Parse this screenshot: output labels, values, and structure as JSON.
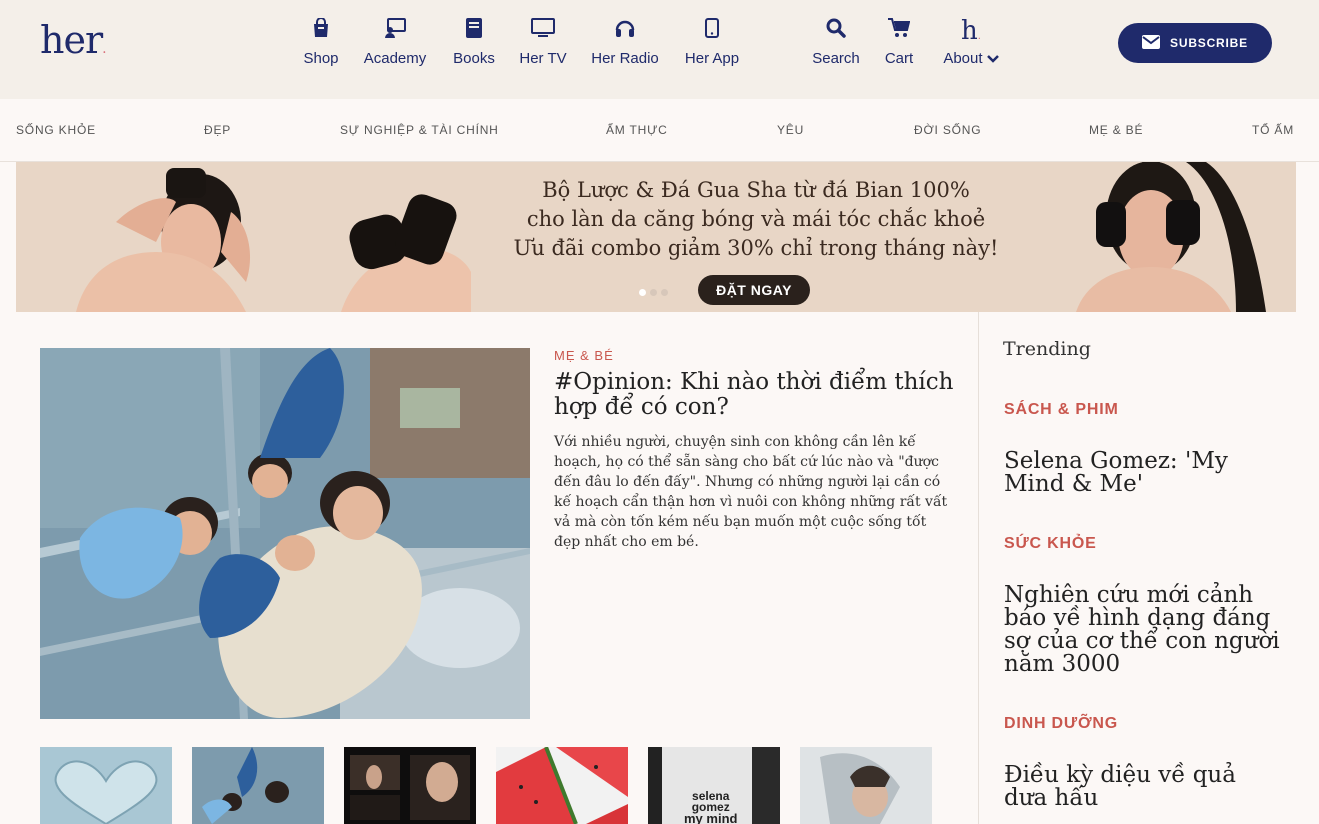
{
  "brand": {
    "logo": "her",
    "logo_dot": "."
  },
  "nav": [
    {
      "label": "Shop",
      "icon": "shopping-bag-icon"
    },
    {
      "label": "Academy",
      "icon": "academy-icon"
    },
    {
      "label": "Books",
      "icon": "book-icon"
    },
    {
      "label": "Her TV",
      "icon": "tv-icon"
    },
    {
      "label": "Her Radio",
      "icon": "headphones-icon"
    },
    {
      "label": "Her App",
      "icon": "phone-icon"
    },
    {
      "label": "Search",
      "icon": "search-icon"
    },
    {
      "label": "Cart",
      "icon": "cart-icon"
    },
    {
      "label": "About",
      "icon": "h-logo-icon"
    }
  ],
  "subscribe": {
    "label": "SUBSCRIBE"
  },
  "categories": [
    "SỐNG KHỎE",
    "ĐẸP",
    "SỰ NGHIỆP & TÀI CHÍNH",
    "ẨM THỰC",
    "YÊU",
    "ĐỜI SỐNG",
    "MẸ & BÉ",
    "TỔ ẤM"
  ],
  "banner": {
    "line1": "Bộ Lược & Đá Gua Sha từ đá Bian 100%",
    "line2": "cho làn da căng bóng và mái tóc chắc khoẻ",
    "line3": "Ưu đãi combo giảm 30% chỉ trong tháng này!",
    "cta": "ĐẶT NGAY"
  },
  "story": {
    "category": "MẸ & BÉ",
    "title": "#Opinion: Khi nào thời điểm thích hợp để có con?",
    "excerpt": "Với nhiều người, chuyện sinh con không cần lên kế hoạch, họ có thể sẵn sàng cho bất cứ lúc nào và \"được đến đâu lo đến đấy\". Nhưng có những người lại cần có kế hoạch cẩn thận hơn vì nuôi con không những rất vất vả mà còn tốn kém nếu bạn muốn một cuộc sống tốt đẹp nhất cho em bé."
  },
  "trending": {
    "heading": "Trending",
    "items": [
      {
        "category": "SÁCH & PHIM",
        "title": "Selena Gomez: 'My Mind & Me'"
      },
      {
        "category": "SỨC KHỎE",
        "title": "Nghiên cứu mới cảnh báo về hình dạng đáng sợ của cơ thể con người năm 3000"
      },
      {
        "category": "DINH DƯỠNG",
        "title": "Điều kỳ diệu về quả dưa hấu"
      }
    ]
  },
  "thumb_texts": {
    "selena_line1": "selena",
    "selena_line2": "gomez",
    "selena_line3": "my mind"
  }
}
